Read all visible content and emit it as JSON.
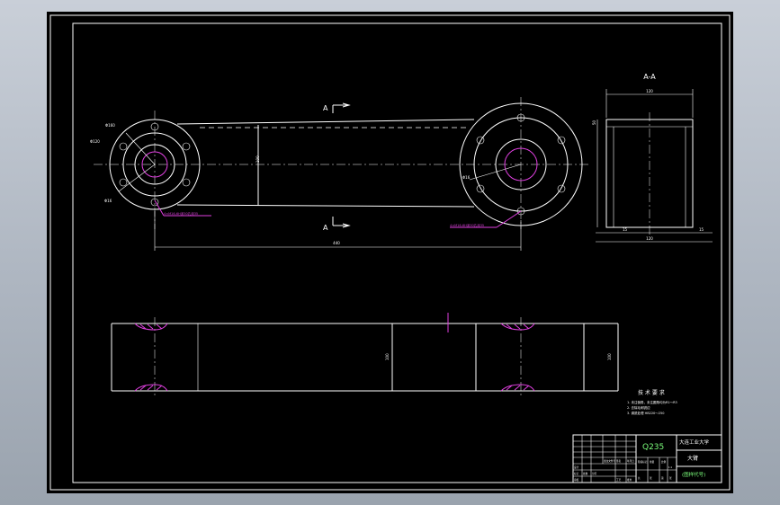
{
  "section_marks": {
    "top": "A",
    "bottom": "A",
    "view_title": "A-A"
  },
  "labels": {
    "length_dim": "440",
    "height_dim": "100",
    "width_dim": "120",
    "width_dim2": "120",
    "left_small": "15",
    "right_small": "15",
    "sec_height": "50",
    "front_h_left": "100",
    "front_h_right": "100",
    "hole_labels": [
      "Φ160",
      "Φ120",
      "Φ16",
      "Φ16"
    ],
    "note_left": "4×M16-6H深30孔深35",
    "note_right": "4×M16-6H深30孔深35"
  },
  "tech_requirements": {
    "title": "技 术 要 求",
    "lines": [
      "1. 未注倒角，未注圆角均为R1～R3",
      "2. 去除毛刺锐边",
      "3. 调质处理 HB220～250"
    ]
  },
  "title_block": {
    "material": "Q235",
    "school": "大连工业大学",
    "part_name": "大臂",
    "drawing_no": "(图样代号)",
    "cells": [
      "标记",
      "处数",
      "分区",
      "更改文件号",
      "签名",
      "年月日",
      "设计",
      "审核",
      "工艺",
      "批准",
      "阶段标记",
      "重量",
      "比例",
      "1:1",
      "共",
      "张",
      "第",
      "张"
    ]
  },
  "colors": {
    "background": "#000000",
    "line": "#ffffff",
    "accent": "#e040e0",
    "title_green": "#7cff7c"
  }
}
